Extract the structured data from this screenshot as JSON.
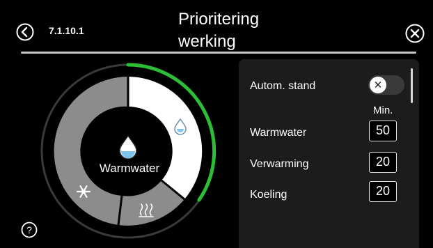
{
  "header": {
    "menu_code": "7.1.10.1",
    "title": "Prioritering werking"
  },
  "icons": {
    "back": "back-arrow-circle-icon",
    "close": "close-x-circle-icon",
    "help": "help-question-circle-icon",
    "water_drop": "water-drop-icon",
    "snowflake": "snowflake-icon",
    "heating": "heating-waves-icon"
  },
  "donut": {
    "center_label": "Warmwater",
    "segments": [
      {
        "name": "Warmwater",
        "fraction": 0.5,
        "color": "#ffffff"
      },
      {
        "name": "Verwarming",
        "fraction": 0.2,
        "color": "#8c8c8c"
      },
      {
        "name": "Koeling",
        "fraction": 0.3,
        "color": "#8c8c8c"
      }
    ],
    "progress_fraction": 0.5,
    "progress_color": "#2dbd36"
  },
  "panel": {
    "auto_label": "Autom. stand",
    "auto_toggle_state": "off",
    "min_header": "Min.",
    "rows": [
      {
        "label": "Warmwater",
        "value": "50"
      },
      {
        "label": "Verwarming",
        "value": "20"
      },
      {
        "label": "Koeling",
        "value": "20"
      }
    ]
  },
  "colors": {
    "background": "#000000",
    "panel": "#1c1c1c",
    "accent_green": "#2dbd36"
  }
}
